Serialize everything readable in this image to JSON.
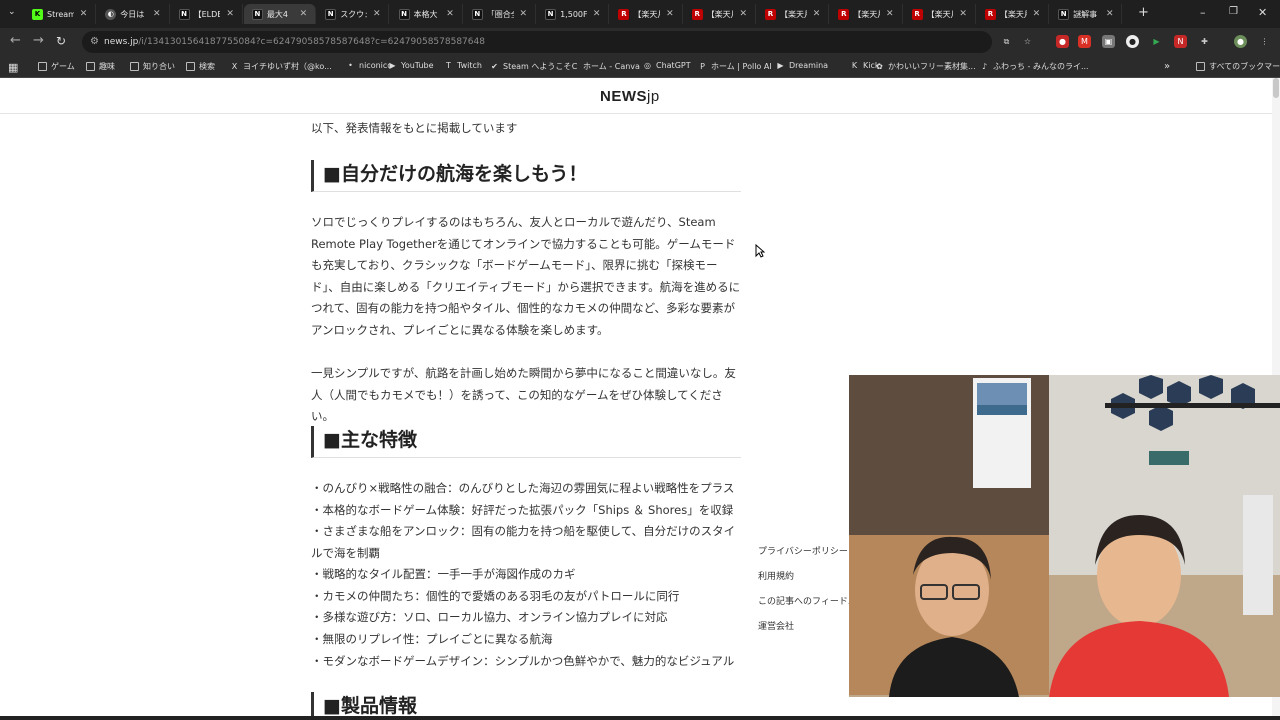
{
  "tabs": [
    {
      "fav": "K",
      "type": "k",
      "label": "Stream",
      "active": false
    },
    {
      "fav": "◐",
      "type": "g",
      "label": "今日は",
      "active": false
    },
    {
      "fav": "N",
      "type": "n",
      "label": "【ELDE",
      "active": false
    },
    {
      "fav": "N",
      "type": "n",
      "label": "最大4",
      "active": true
    },
    {
      "fav": "N",
      "type": "n",
      "label": "スクウェ",
      "active": false
    },
    {
      "fav": "N",
      "type": "n",
      "label": "本格大",
      "active": false
    },
    {
      "fav": "N",
      "type": "n",
      "label": "「圏合全",
      "active": false
    },
    {
      "fav": "N",
      "type": "n",
      "label": "1,500F",
      "active": false
    },
    {
      "fav": "R",
      "type": "r",
      "label": "【楽天月",
      "active": false
    },
    {
      "fav": "R",
      "type": "r",
      "label": "【楽天月",
      "active": false
    },
    {
      "fav": "R",
      "type": "r",
      "label": "【楽天月",
      "active": false
    },
    {
      "fav": "R",
      "type": "r",
      "label": "【楽天月",
      "active": false
    },
    {
      "fav": "R",
      "type": "r",
      "label": "【楽天月",
      "active": false
    },
    {
      "fav": "R",
      "type": "r",
      "label": "【楽天月",
      "active": false
    },
    {
      "fav": "N",
      "type": "n",
      "label": "謎解事",
      "active": false
    }
  ],
  "address": {
    "host": "news.jp",
    "path": "/i/1341301564187755084?c=62479058578587648?c=62479058578587648"
  },
  "bookmarks": [
    {
      "icon": "folder",
      "label": "ゲーム"
    },
    {
      "icon": "folder",
      "label": "趣味"
    },
    {
      "icon": "folder",
      "label": "知り合い"
    },
    {
      "icon": "folder",
      "label": "検索"
    },
    {
      "icon": "X",
      "label": "ヨイチゆいず村（@ko..."
    },
    {
      "icon": "•",
      "label": "niconico"
    },
    {
      "icon": "▶",
      "label": "YouTube"
    },
    {
      "icon": "T",
      "label": "Twitch"
    },
    {
      "icon": "✔",
      "label": "Steam へようこそ"
    },
    {
      "icon": "C",
      "label": "ホーム - Canva"
    },
    {
      "icon": "◎",
      "label": "ChatGPT"
    },
    {
      "icon": "P",
      "label": "ホーム | Pollo AI"
    },
    {
      "icon": "▶",
      "label": "Dreamina"
    },
    {
      "icon": "K",
      "label": "Kick"
    },
    {
      "icon": "✿",
      "label": "かわいいフリー素材集..."
    },
    {
      "icon": "♪",
      "label": "ふわっち - みんなのライ..."
    }
  ],
  "bookmarks_all": "すべてのブックマーク",
  "site": {
    "logo_main": "NEWS",
    "logo_suffix": "jp"
  },
  "article": {
    "intro": "以下、発表情報をもとに掲載しています",
    "h_voyage": "■自分だけの航海を楽しもう！",
    "p1": "ソロでじっくりプレイするのはもちろん、友人とローカルで遊んだり、Steam Remote Play Togetherを通じてオンラインで協力することも可能。ゲームモードも充実しており、クラシックな「ボードゲームモード」、限界に挑む「探検モード」、自由に楽しめる「クリエイティブモード」から選択できます。航海を進めるにつれて、固有の能力を持つ船やタイル、個性的なカモメの仲間など、多彩な要素がアンロックされ、プレイごとに異なる体験を楽しめます。",
    "p2": "一見シンプルですが、航路を計画し始めた瞬間から夢中になること間違いなし。友人（人間でもカモメでも！）を誘って、この知的なゲームをぜひ体験してください。",
    "h_features": "■主な特徴",
    "features": [
      "・のんびり×戦略性の融合：のんびりとした海辺の雰囲気に程よい戦略性をプラス",
      "・本格的なボードゲーム体験：好評だった拡張パック「Ships ＆ Shores」を収録",
      "・さまざまな船をアンロック：固有の能力を持つ船を駆使して、自分だけのスタイルで海を制覇",
      "・戦略的なタイル配置：一手一手が海図作成のカギ",
      "・カモメの仲間たち：個性的で愛嬌のある羽毛の友がパトロールに同行",
      "・多様な遊び方：ソロ、ローカル協力、オンライン協力プレイに対応",
      "・無限のリプレイ性：プレイごとに異なる航海",
      "・モダンなボードゲームデザイン：シンプルかつ色鮮やかで、魅力的なビジュアル"
    ],
    "h_product": "■製品情報"
  },
  "footer_links": [
    "プライバシーポリシー",
    "利用規約",
    "この記事へのフィードバック",
    "運営会社"
  ],
  "colors": {
    "tabbar": "#1f1f1f",
    "toolbar": "#2b2b2b",
    "text": "#333333",
    "heading_bar": "#333333"
  }
}
